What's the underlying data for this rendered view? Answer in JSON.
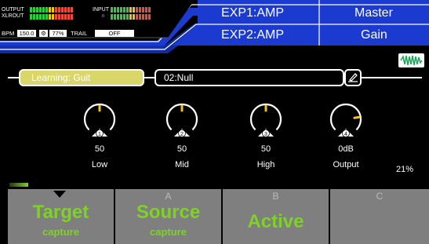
{
  "status": {
    "output_label": "OUTPUT",
    "xlrout_label": "XLROUT",
    "input_label": "INPUT",
    "bpm_label": "BPM",
    "bpm_value": "150.0",
    "level_value": "77%",
    "trail_label": "TRAIL",
    "trail_value": "OFF"
  },
  "header": {
    "exp1": "EXP1:AMP",
    "exp1_param": "Master",
    "exp2": "EXP2:AMP",
    "exp2_param": "Gain"
  },
  "learning": {
    "pill_label": "Learning: Guit",
    "name_value": "02:Null"
  },
  "knobs": [
    {
      "number": "1",
      "value": "50",
      "label": "Low",
      "level": 0.5
    },
    {
      "number": "2",
      "value": "50",
      "label": "Mid",
      "level": 0.5
    },
    {
      "number": "3",
      "value": "50",
      "label": "High",
      "level": 0.5
    },
    {
      "number": "4",
      "value": "0dB",
      "label": "Output",
      "level": 0.8
    }
  ],
  "progress_percent": "21%",
  "progress_fraction": 0.21,
  "slots": [
    {
      "label": "",
      "big": "Target",
      "small": "capture"
    },
    {
      "label": "A",
      "big": "Source",
      "small": "capture"
    },
    {
      "label": "B",
      "big": "Active",
      "small": ""
    },
    {
      "label": "C",
      "big": "",
      "small": ""
    }
  ],
  "colors": {
    "accent_green": "#7dd321",
    "header_blue": "#1838c8",
    "pill_yellow": "#d9d66a",
    "knob_indicator": "#f1c21b",
    "slot_gray": "#7f7f7f"
  }
}
